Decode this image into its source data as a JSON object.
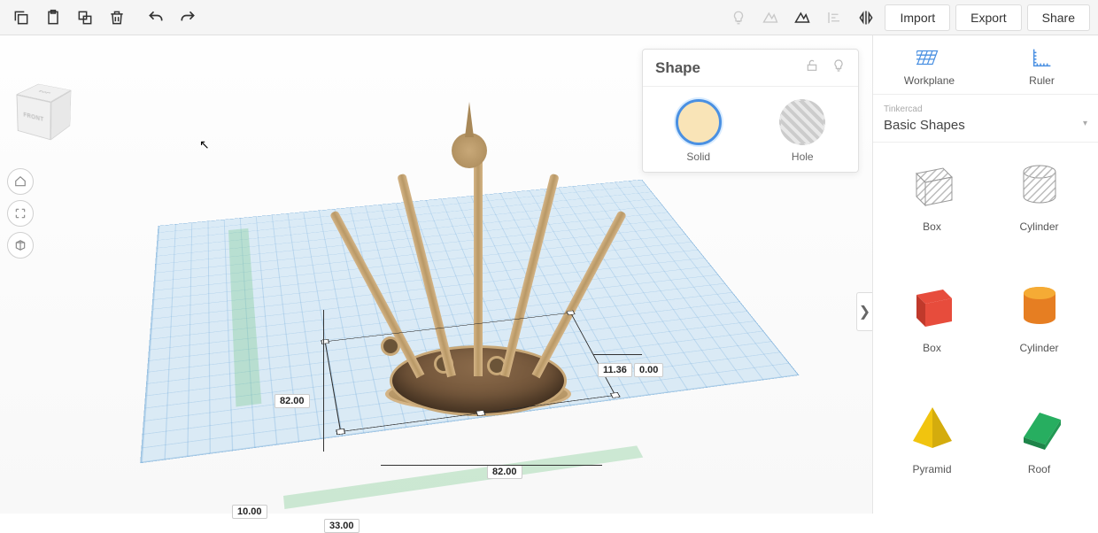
{
  "toolbar": {
    "import": "Import",
    "export": "Export",
    "share": "Share"
  },
  "viewcube": {
    "top": "TOP",
    "front": "FRONT"
  },
  "shape_panel": {
    "title": "Shape",
    "solid": "Solid",
    "hole": "Hole"
  },
  "sidebar": {
    "workplane": "Workplane",
    "ruler": "Ruler",
    "provider": "Tinkercad",
    "category": "Basic Shapes",
    "shapes": {
      "box_hatched": "Box",
      "cylinder_hatched": "Cylinder",
      "box_red": "Box",
      "cylinder_orange": "Cylinder",
      "pyramid": "Pyramid",
      "roof": "Roof"
    }
  },
  "dimensions": {
    "width": "82.00",
    "depth": "82.00",
    "height1": "11.36",
    "height2": "0.00",
    "ruler_x": "33.00",
    "ruler_y": "10.00"
  }
}
